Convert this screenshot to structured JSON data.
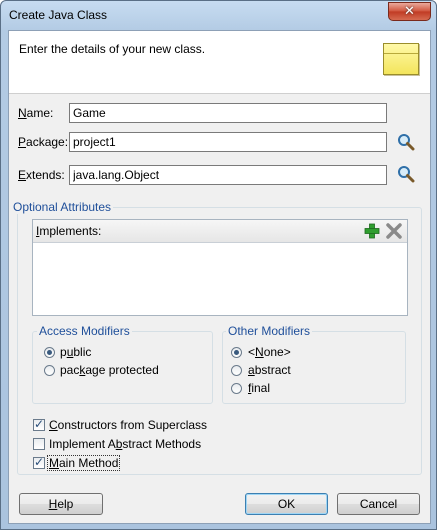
{
  "window": {
    "title": "Create Java Class"
  },
  "header": {
    "text": "Enter the details of your new class."
  },
  "fields": {
    "name": {
      "label_prefix": "",
      "label_u": "N",
      "label_rest": "ame:",
      "value": "Game"
    },
    "package": {
      "label_prefix": "",
      "label_u": "P",
      "label_rest": "ackage:",
      "value": "project1"
    },
    "extends": {
      "label_prefix": "",
      "label_u": "E",
      "label_rest": "xtends:",
      "value": "java.lang.Object"
    }
  },
  "optional": {
    "title": "Optional Attributes",
    "implements_label_u": "I",
    "implements_label_rest": "mplements:"
  },
  "access": {
    "title": "Access Modifiers",
    "options": [
      {
        "pre": "p",
        "u": "u",
        "post": "blic",
        "selected": true
      },
      {
        "pre": "pac",
        "u": "k",
        "post": "age protected",
        "selected": false
      }
    ]
  },
  "other": {
    "title": "Other Modifiers",
    "options": [
      {
        "pre": "<",
        "u": "N",
        "post": "one>",
        "selected": true
      },
      {
        "pre": "",
        "u": "a",
        "post": "bstract",
        "selected": false
      },
      {
        "pre": "",
        "u": "f",
        "post": "inal",
        "selected": false
      }
    ]
  },
  "checks": [
    {
      "pre": "",
      "u": "C",
      "post": "onstructors from Superclass",
      "checked": true
    },
    {
      "pre": "Implement A",
      "u": "b",
      "post": "stract Methods",
      "checked": false
    },
    {
      "pre": "",
      "u": "M",
      "post": "ain Method",
      "checked": true
    }
  ],
  "buttons": {
    "help_u": "H",
    "help_rest": "elp",
    "ok": "OK",
    "cancel": "Cancel"
  },
  "colors": {
    "group_title": "#1f4f9a",
    "add": "#2f9e2f"
  }
}
